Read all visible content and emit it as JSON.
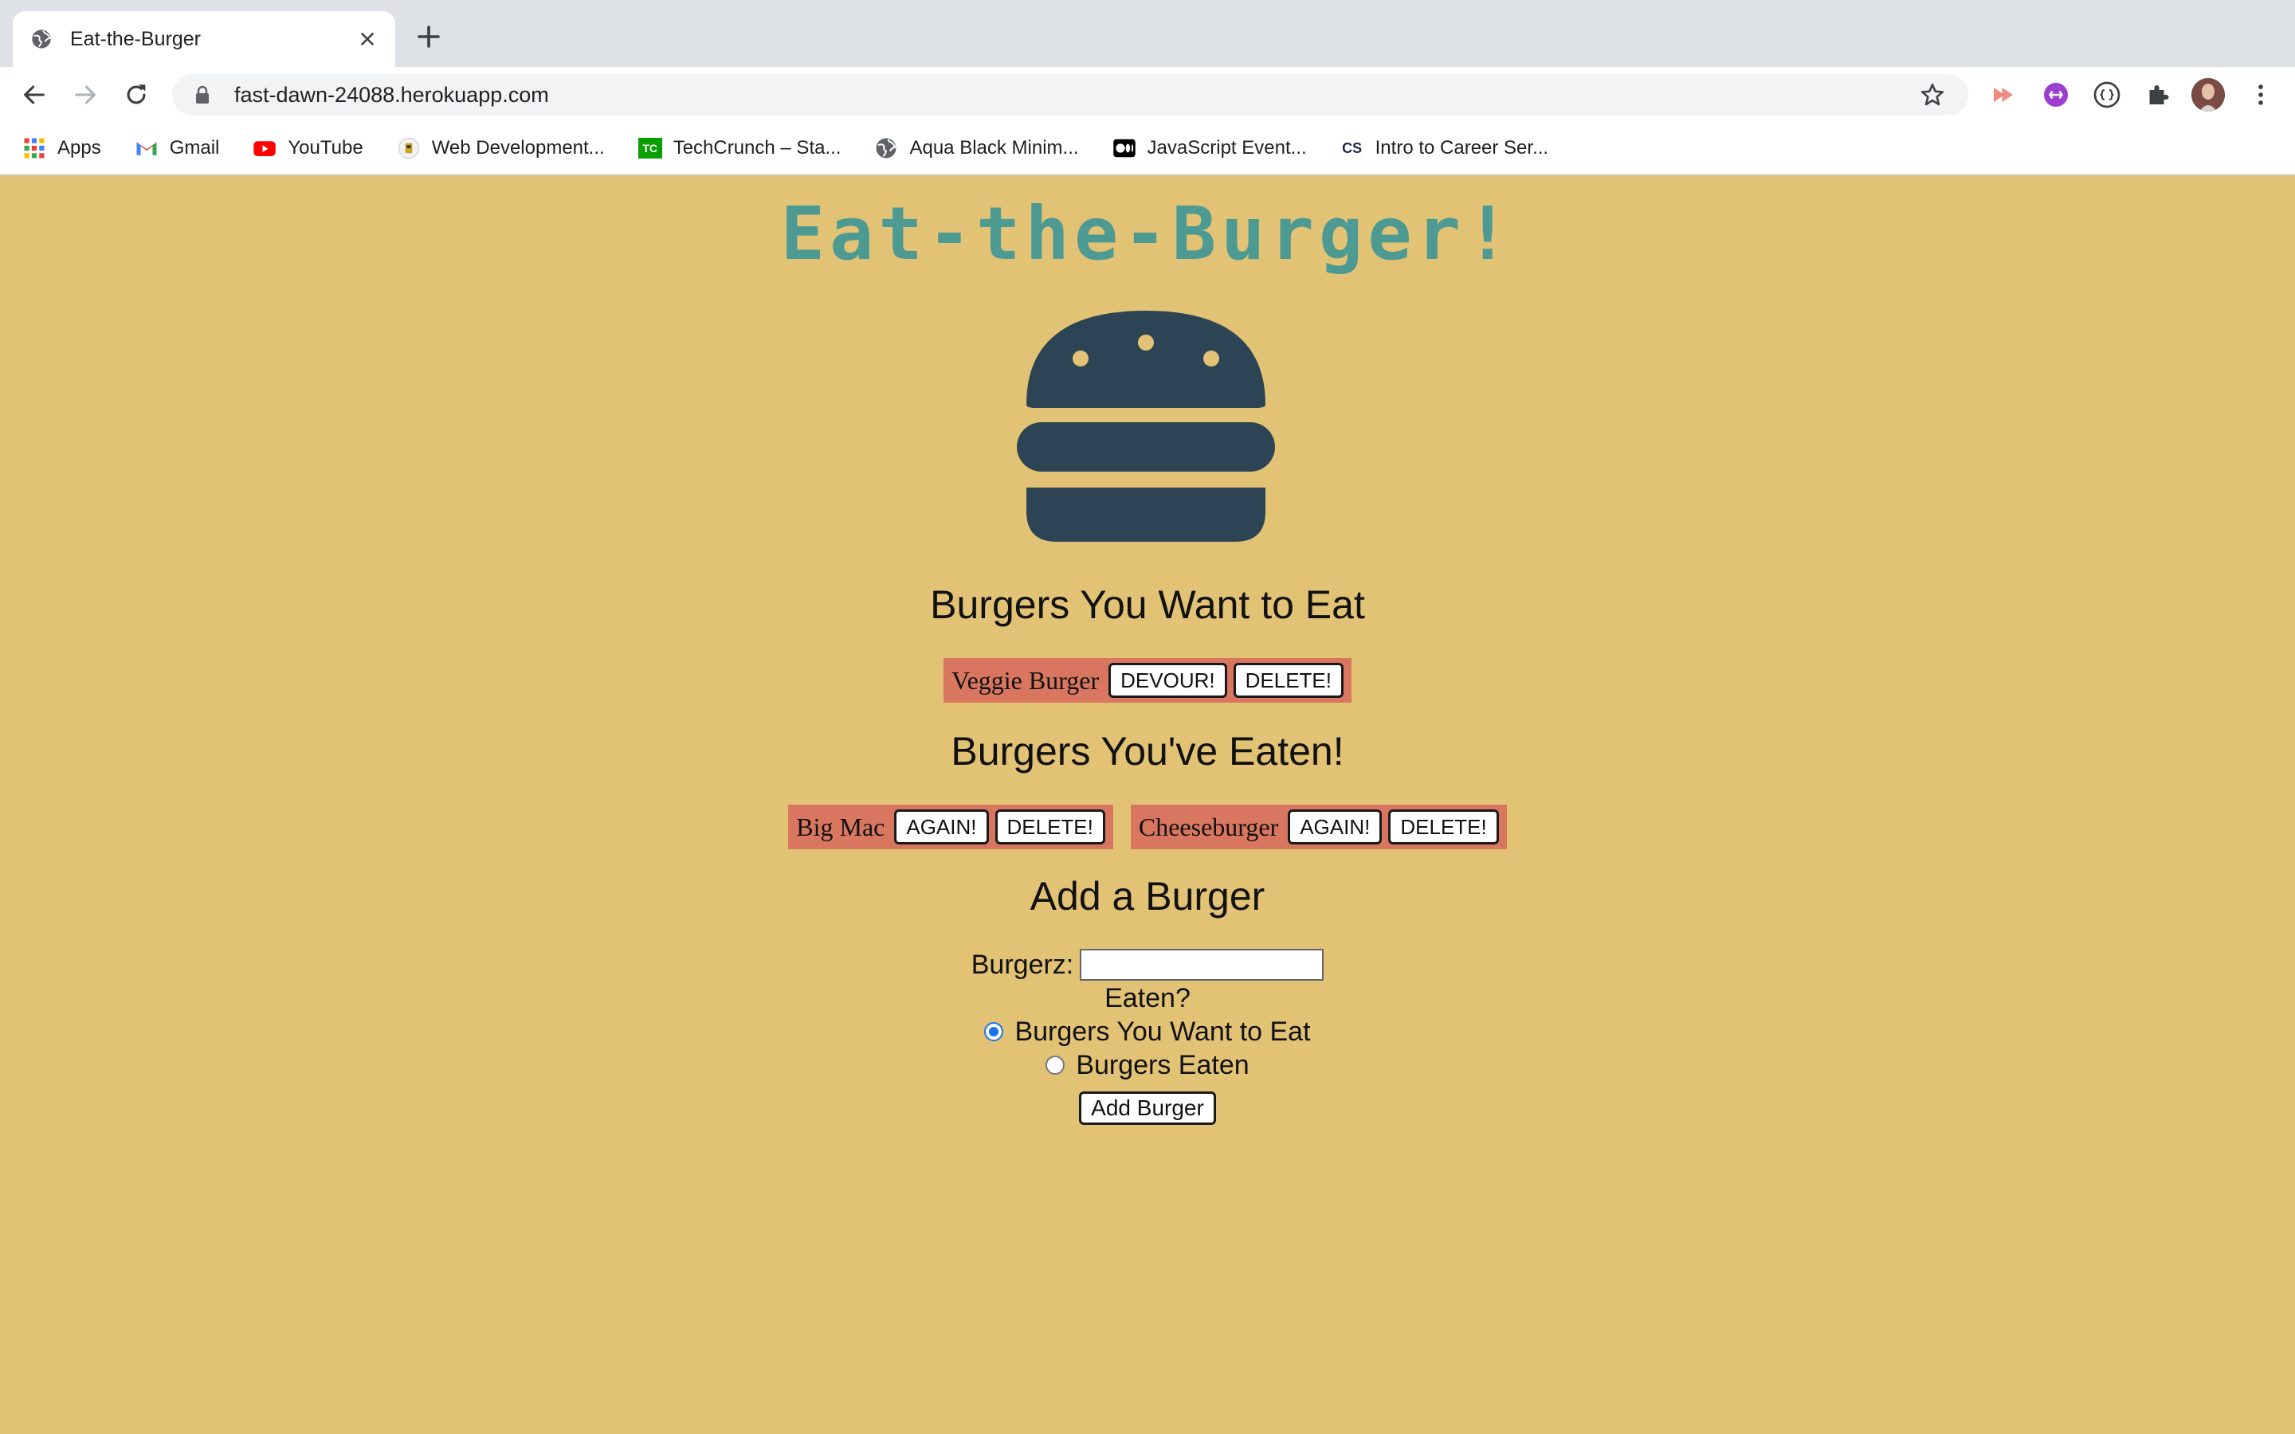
{
  "browser": {
    "tab_title": "Eat-the-Burger",
    "url": "fast-dawn-24088.herokuapp.com",
    "bookmarks": [
      {
        "label": "Apps",
        "icon": "apps-grid-icon"
      },
      {
        "label": "Gmail",
        "icon": "gmail-icon"
      },
      {
        "label": "YouTube",
        "icon": "youtube-icon"
      },
      {
        "label": "Web Development...",
        "icon": "bookmark-favicon-icon"
      },
      {
        "label": "TechCrunch – Sta...",
        "icon": "techcrunch-icon"
      },
      {
        "label": "Aqua Black Minim...",
        "icon": "globe-icon"
      },
      {
        "label": "JavaScript Event...",
        "icon": "medium-icon"
      },
      {
        "label": "Intro to Career Ser...",
        "icon": "cs-icon"
      }
    ],
    "techcrunch_badge": "TC",
    "cs_badge": "CS"
  },
  "page": {
    "title": "Eat-the-Burger!",
    "want_heading": "Burgers You Want to Eat",
    "want_items": [
      {
        "name": "Veggie Burger",
        "action": "DEVOUR!",
        "delete": "DELETE!"
      }
    ],
    "eaten_heading": "Burgers You've Eaten!",
    "eaten_items": [
      {
        "name": "Big Mac",
        "action": "AGAIN!",
        "delete": "DELETE!"
      },
      {
        "name": "Cheeseburger",
        "action": "AGAIN!",
        "delete": "DELETE!"
      }
    ],
    "add_heading": "Add a Burger",
    "form": {
      "input_label": "Burgerz:",
      "input_value": "",
      "eaten_label": "Eaten?",
      "radio_want": "Burgers You Want to Eat",
      "radio_eaten": "Burgers Eaten",
      "selected": "want",
      "submit": "Add Burger"
    }
  },
  "colors": {
    "background": "#e2c375",
    "title": "#4d9a92",
    "chip": "#d87660",
    "burger": "#2c4453"
  }
}
